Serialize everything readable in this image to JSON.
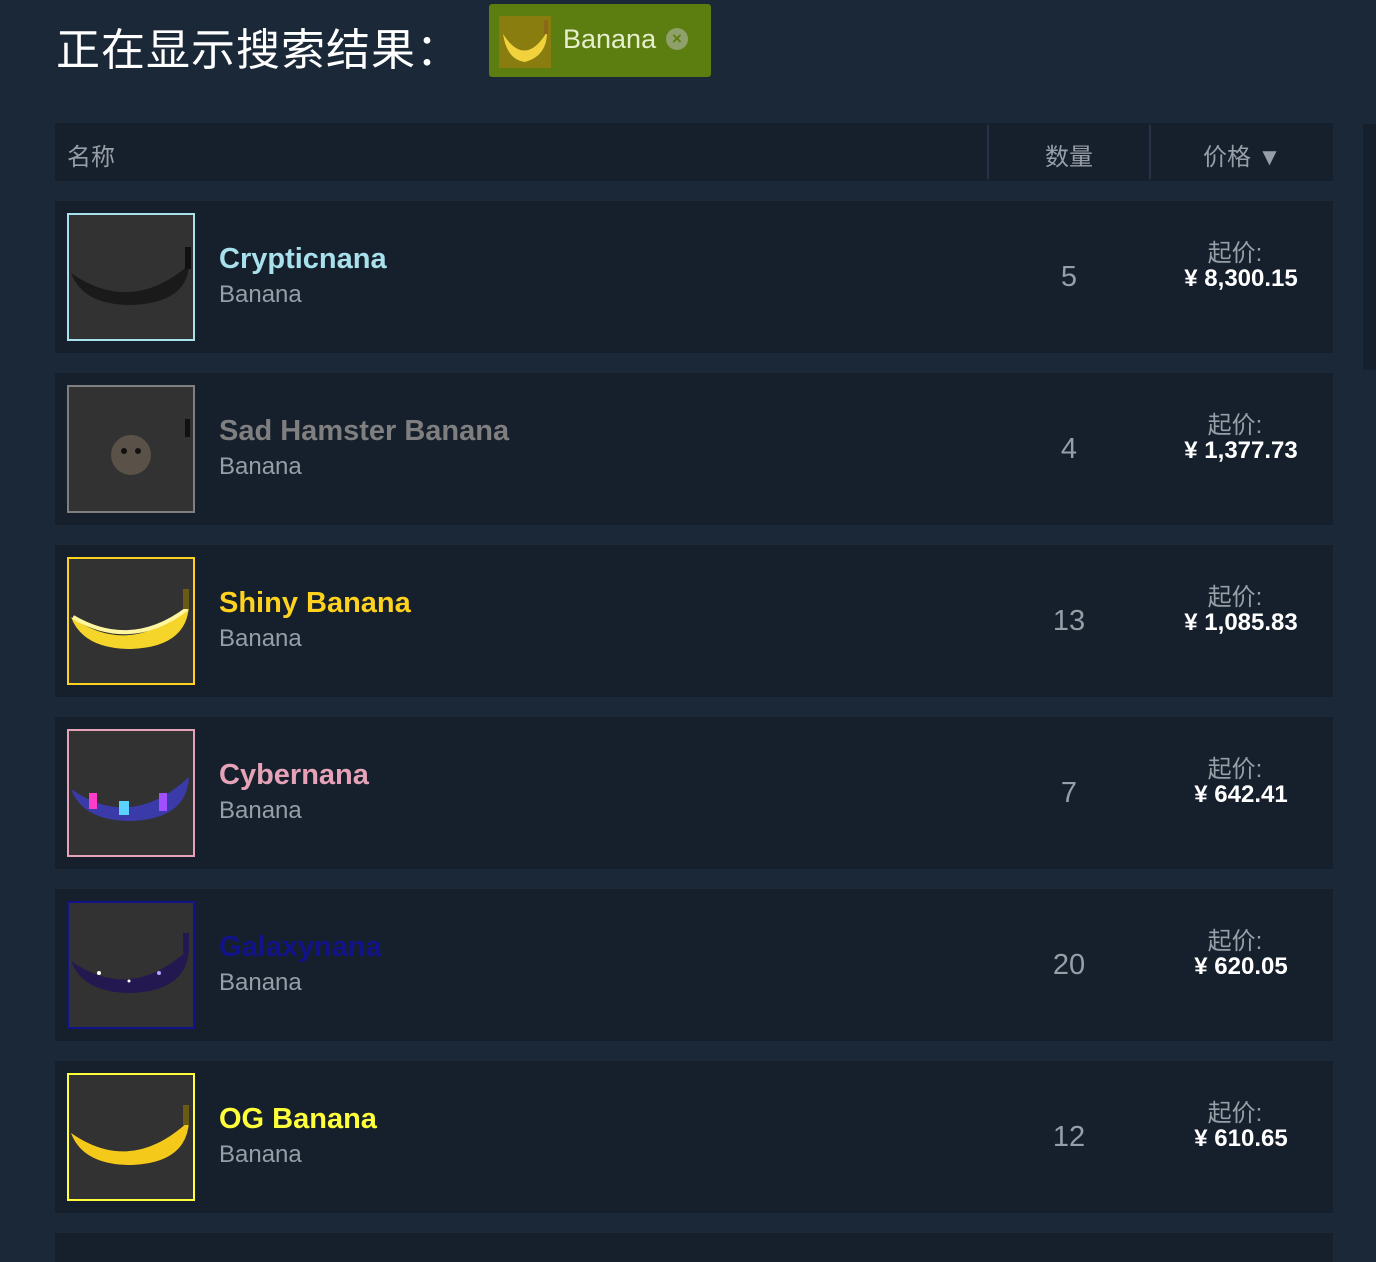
{
  "page": {
    "title": "正在显示搜索结果：",
    "filter_tag": {
      "label": "Banana",
      "close_icon": "close-circle-icon"
    }
  },
  "table": {
    "headers": {
      "name": "名称",
      "quantity": "数量",
      "price": "价格 ▼"
    }
  },
  "listings": [
    {
      "name": "Crypticnana",
      "game": "Banana",
      "quantity": "5",
      "price_label": "起价:",
      "price": "¥ 8,300.15",
      "name_color": "#a8e0eb",
      "border_color": "#a8e0eb"
    },
    {
      "name": "Sad Hamster Banana",
      "game": "Banana",
      "quantity": "4",
      "price_label": "起价:",
      "price": "¥ 1,377.73",
      "name_color": "#7f7f7f",
      "border_color": "#7f7f7f"
    },
    {
      "name": "Shiny Banana",
      "game": "Banana",
      "quantity": "13",
      "price_label": "起价:",
      "price": "¥ 1,085.83",
      "name_color": "#ffd21f",
      "border_color": "#ffd21f"
    },
    {
      "name": "Cybernana",
      "game": "Banana",
      "quantity": "7",
      "price_label": "起价:",
      "price": "¥ 642.41",
      "name_color": "#e6a3b8",
      "border_color": "#e6a3b8"
    },
    {
      "name": "Galaxynana",
      "game": "Banana",
      "quantity": "20",
      "price_label": "起价:",
      "price": "¥ 620.05",
      "name_color": "#12128a",
      "border_color": "#12128a"
    },
    {
      "name": "OG Banana",
      "game": "Banana",
      "quantity": "12",
      "price_label": "起价:",
      "price": "¥ 610.65",
      "name_color": "#ffff3a",
      "border_color": "#ffff3a"
    }
  ]
}
